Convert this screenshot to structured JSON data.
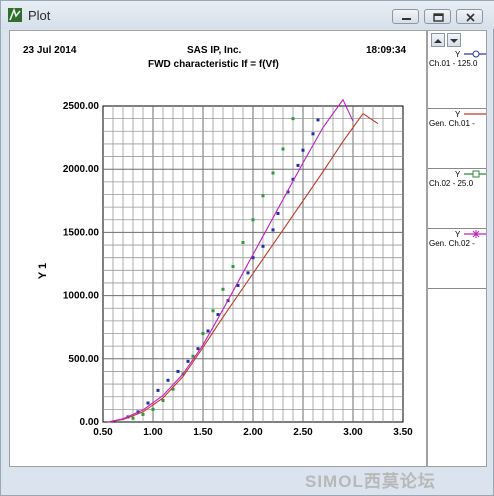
{
  "window": {
    "title": "Plot",
    "controls": {
      "minimize": "minimize",
      "restore": "restore",
      "close": "close"
    }
  },
  "header": {
    "date": "23 Jul 2014",
    "company": "SAS IP, Inc.",
    "time": "18:09:34",
    "subtitle": "FWD characteristic If = f(Vf)"
  },
  "legend": [
    {
      "y": "Y",
      "name": "Ch.01 - 125.0",
      "color": "#2a3a9a",
      "marker": "circle"
    },
    {
      "y": "Y",
      "name": "Gen. Ch.01 -",
      "color": "#c0392b",
      "marker": "line"
    },
    {
      "y": "Y",
      "name": "Ch.02 - 25.0",
      "color": "#2e8b3a",
      "marker": "square"
    },
    {
      "y": "Y",
      "name": "Gen. Ch.02 -",
      "color": "#c020c0",
      "marker": "asterisk"
    }
  ],
  "watermark": {
    "text": "SIMOL西莫论坛"
  },
  "chart_data": {
    "type": "scatter",
    "title": "FWD characteristic If = f(Vf)",
    "xlabel": "",
    "ylabel": "Y 1",
    "xlim": [
      0.5,
      3.5
    ],
    "ylim": [
      0,
      2500
    ],
    "xticks": [
      "0.50",
      "1.00",
      "1.50",
      "2.00",
      "2.50",
      "3.00",
      "3.50"
    ],
    "yticks": [
      "0.00",
      "500.00",
      "1000.00",
      "1500.00",
      "2000.00",
      "2500.00"
    ],
    "grid": true,
    "series": [
      {
        "name": "Ch.01 - 125.0",
        "color": "#1f2fa8",
        "mode": "markers",
        "points": [
          [
            0.75,
            40
          ],
          [
            0.85,
            80
          ],
          [
            0.95,
            150
          ],
          [
            1.05,
            250
          ],
          [
            1.15,
            330
          ],
          [
            1.25,
            400
          ],
          [
            1.35,
            480
          ],
          [
            1.45,
            580
          ],
          [
            1.55,
            720
          ],
          [
            1.65,
            850
          ],
          [
            1.75,
            960
          ],
          [
            1.85,
            1080
          ],
          [
            1.95,
            1180
          ],
          [
            2.0,
            1300
          ],
          [
            2.1,
            1390
          ],
          [
            2.2,
            1520
          ],
          [
            2.25,
            1650
          ],
          [
            2.35,
            1820
          ],
          [
            2.4,
            1920
          ],
          [
            2.45,
            2030
          ],
          [
            2.5,
            2150
          ],
          [
            2.6,
            2280
          ],
          [
            2.65,
            2390
          ]
        ]
      },
      {
        "name": "Ch.02 - 25.0",
        "color": "#2e9a3a",
        "mode": "markers",
        "points": [
          [
            0.8,
            30
          ],
          [
            0.9,
            60
          ],
          [
            1.0,
            100
          ],
          [
            1.1,
            170
          ],
          [
            1.2,
            260
          ],
          [
            1.3,
            380
          ],
          [
            1.4,
            520
          ],
          [
            1.5,
            700
          ],
          [
            1.6,
            880
          ],
          [
            1.7,
            1050
          ],
          [
            1.8,
            1230
          ],
          [
            1.9,
            1420
          ],
          [
            2.0,
            1600
          ],
          [
            2.1,
            1790
          ],
          [
            2.2,
            1970
          ],
          [
            2.3,
            2160
          ],
          [
            2.4,
            2400
          ]
        ]
      },
      {
        "name": "Gen. Ch.01",
        "color": "#c0392b",
        "mode": "line",
        "points": [
          [
            0.55,
            0
          ],
          [
            0.7,
            20
          ],
          [
            0.9,
            80
          ],
          [
            1.1,
            190
          ],
          [
            1.3,
            360
          ],
          [
            1.5,
            590
          ],
          [
            1.7,
            830
          ],
          [
            1.9,
            1060
          ],
          [
            2.1,
            1290
          ],
          [
            2.3,
            1520
          ],
          [
            2.5,
            1750
          ],
          [
            2.7,
            1980
          ],
          [
            2.9,
            2220
          ],
          [
            3.1,
            2440
          ],
          [
            3.25,
            2360
          ]
        ]
      },
      {
        "name": "Gen. Ch.02",
        "color": "#c020c0",
        "mode": "line",
        "points": [
          [
            0.55,
            0
          ],
          [
            0.7,
            25
          ],
          [
            0.9,
            95
          ],
          [
            1.1,
            210
          ],
          [
            1.3,
            380
          ],
          [
            1.5,
            610
          ],
          [
            1.7,
            890
          ],
          [
            1.9,
            1180
          ],
          [
            2.1,
            1470
          ],
          [
            2.3,
            1760
          ],
          [
            2.5,
            2050
          ],
          [
            2.7,
            2330
          ],
          [
            2.9,
            2550
          ],
          [
            3.0,
            2380
          ]
        ]
      }
    ]
  }
}
